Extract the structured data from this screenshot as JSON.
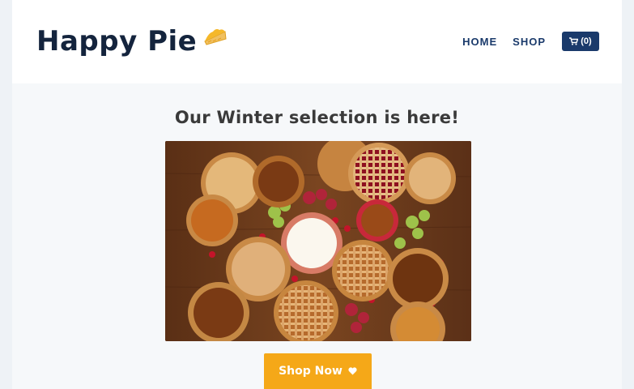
{
  "brand": {
    "name": "Happy Pie",
    "logo_icon": "pie-slice-icon"
  },
  "nav": {
    "items": [
      {
        "label": "HOME"
      },
      {
        "label": "SHOP"
      }
    ],
    "cart": {
      "icon": "cart-icon",
      "label": "(0)"
    }
  },
  "main": {
    "headline": "Our Winter selection is here!",
    "hero_image": {
      "subject": "pies-platter"
    },
    "cta": {
      "label": "Shop Now",
      "icon": "heart-icon"
    }
  },
  "colors": {
    "navy": "#1a3a6b",
    "logo_text": "#14243d",
    "cta_orange": "#f5a818",
    "background": "#f6f8fa"
  }
}
